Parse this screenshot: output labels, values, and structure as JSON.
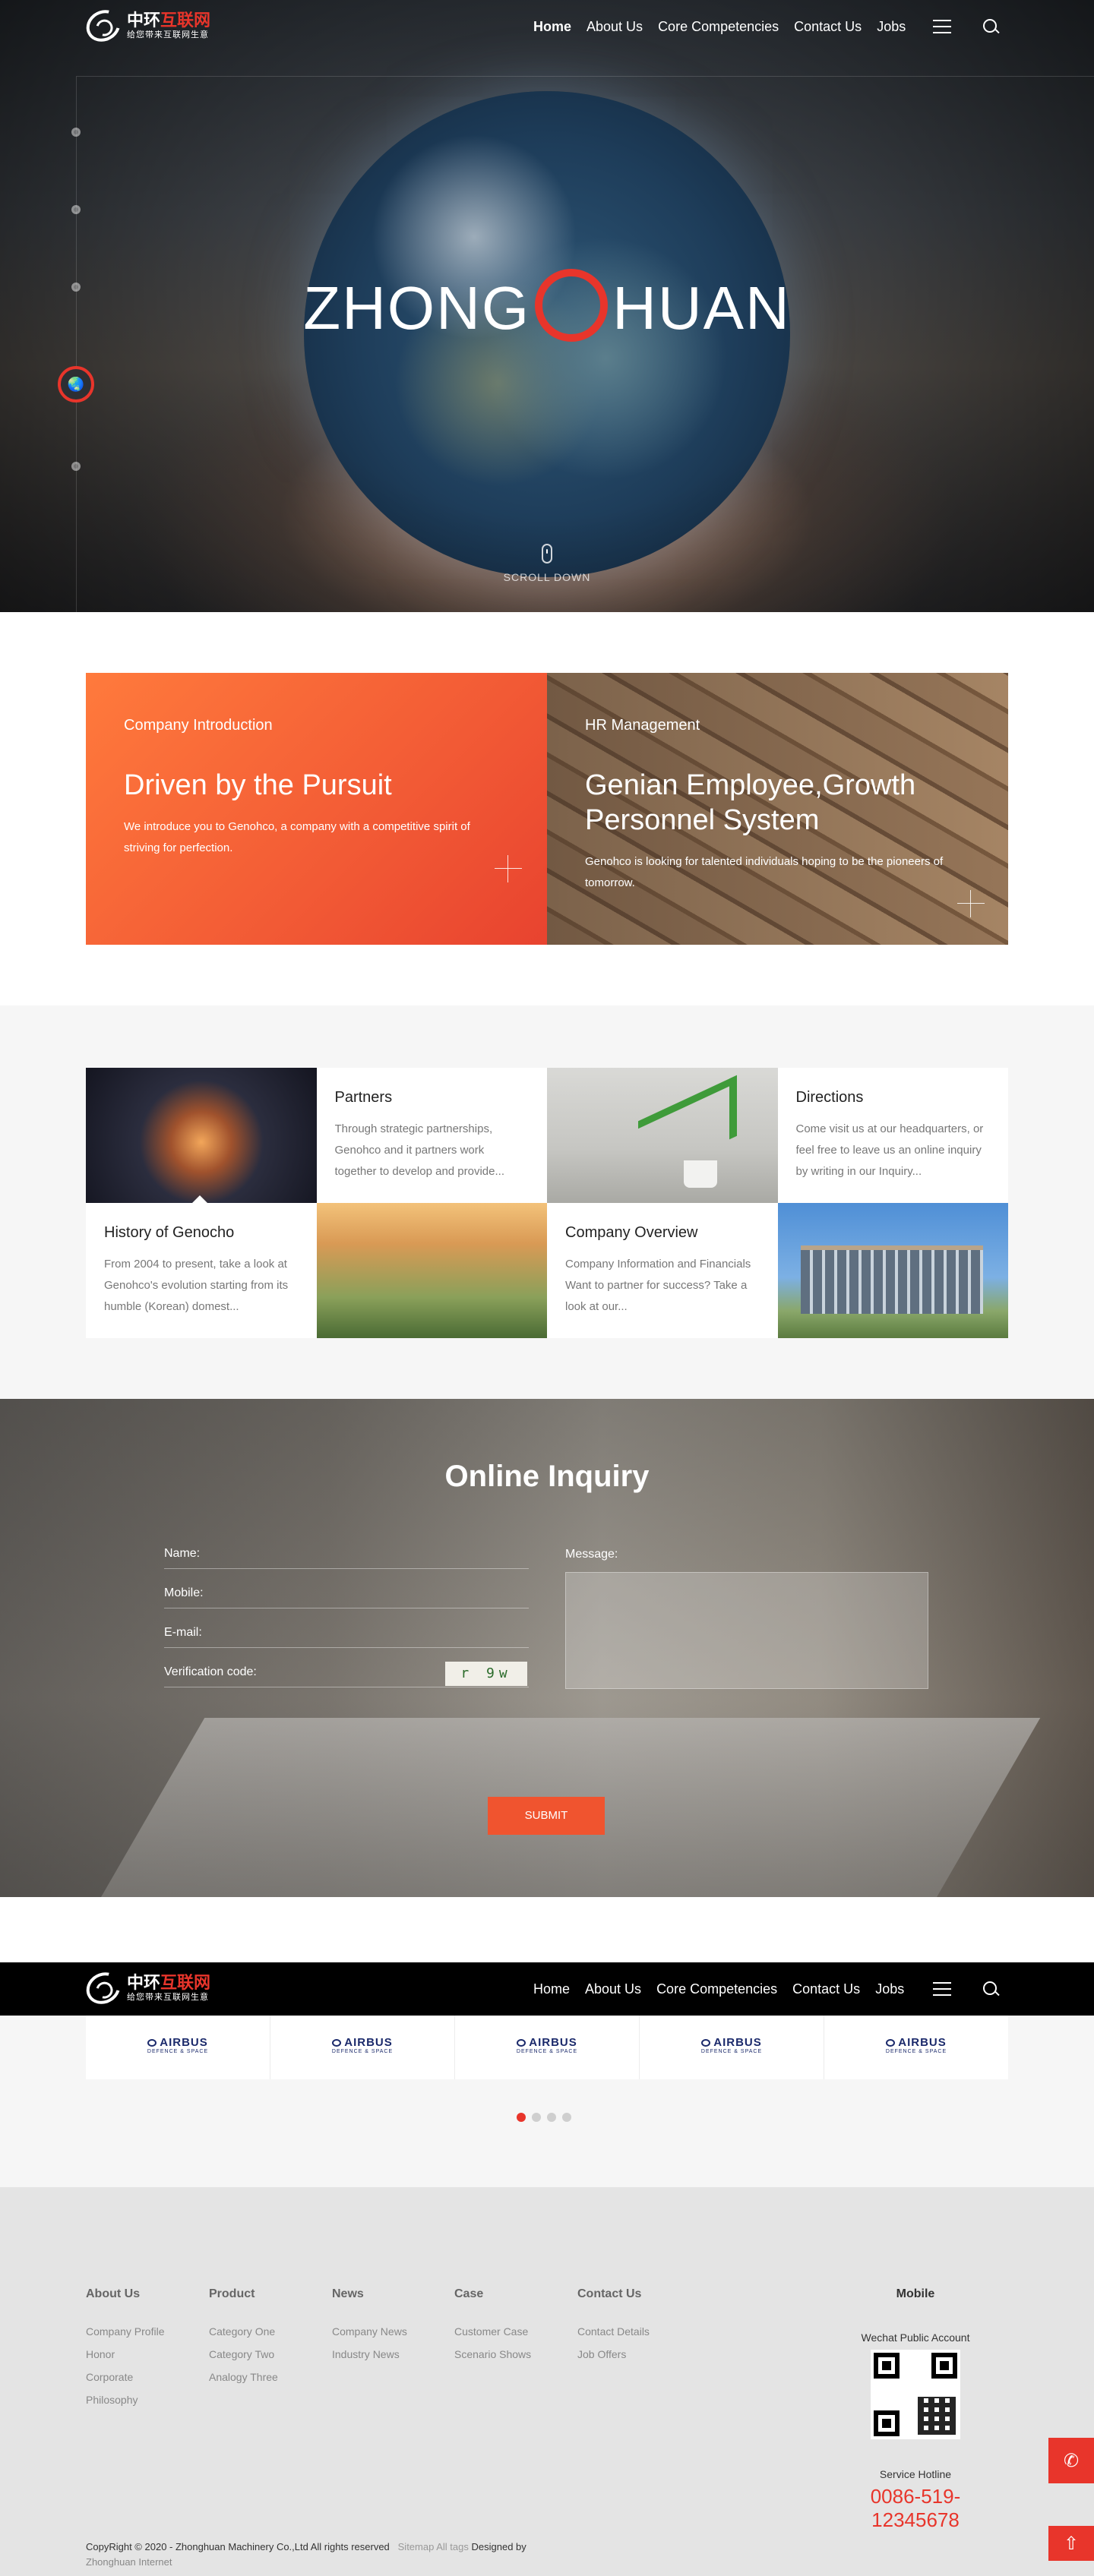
{
  "brand": {
    "name_cn_1": "中环",
    "name_cn_2": "互联网",
    "tagline_cn": "给您带来互联网生意"
  },
  "nav": {
    "items": [
      "Home",
      "About Us",
      "Core Competencies",
      "Contact Us",
      "Jobs"
    ],
    "active": "Home"
  },
  "hero": {
    "title_left": "ZHONG",
    "title_right": "HUAN",
    "scroll_label": "SCROLL DOWN",
    "active_dot_icon": "globe-icon"
  },
  "promo": [
    {
      "kicker": "Company Introduction",
      "title": "Driven by the Pursuit",
      "desc": "We introduce you to Genohco, a company with a competitive spirit of striving for perfection."
    },
    {
      "kicker": "HR Management",
      "title": "Genian Employee,Growth Personnel System",
      "desc": "Genohco is looking for talented individuals hoping to be the pioneers of tomorrow."
    }
  ],
  "grid": [
    {
      "title": "Partners",
      "desc": "Through strategic partnerships, Genohco and it partners work together to develop and provide..."
    },
    {
      "title": "Directions",
      "desc": "Come visit us at our headquarters, or feel free to leave us an online inquiry by writing in our Inquiry..."
    },
    {
      "title": "History of Genocho",
      "desc": "From 2004 to present, take a look at Genohco's evolution starting from its humble (Korean) domest..."
    },
    {
      "title": "Company Overview",
      "desc": "Company Information and Financials Want to partner for success? Take a look at our..."
    }
  ],
  "inquiry": {
    "title": "Online Inquiry",
    "name_label": "Name:",
    "mobile_label": "Mobile:",
    "email_label": "E-mail:",
    "verify_label": "Verification code:",
    "message_label": "Message:",
    "captcha": "r 9w",
    "submit": "SUBMIT"
  },
  "partners": {
    "logo_text": "AIRBUS",
    "logo_sub": "DEFENCE & SPACE",
    "count": 5,
    "active_page": 1,
    "pages": 4
  },
  "footer": {
    "columns": [
      {
        "title": "About Us",
        "links": [
          "Company Profile",
          "Honor",
          "Corporate",
          "Philosophy"
        ]
      },
      {
        "title": "Product",
        "links": [
          "Category One",
          "Category Two",
          "Analogy Three"
        ]
      },
      {
        "title": "News",
        "links": [
          "Company News",
          "Industry News"
        ]
      },
      {
        "title": "Case",
        "links": [
          "Customer Case",
          "Scenario Shows"
        ]
      },
      {
        "title": "Contact Us",
        "links": [
          "Contact Details",
          "Job Offers"
        ]
      }
    ],
    "mobile_title": "Mobile",
    "wechat_label": "Wechat Public Account",
    "hotline_label": "Service Hotline",
    "hotline": "0086-519-12345678",
    "copyright": "CopyRight © 2020 - Zhonghuan Machinery Co.,Ltd All rights reserved",
    "sitemap": "Sitemap",
    "tags": "All tags",
    "designed_by": "Designed by",
    "designer": "Zhonghuan Internet"
  },
  "colors": {
    "accent": "#e8352b",
    "orange": "#f25a35",
    "footer_bg": "#e4e4e4"
  }
}
